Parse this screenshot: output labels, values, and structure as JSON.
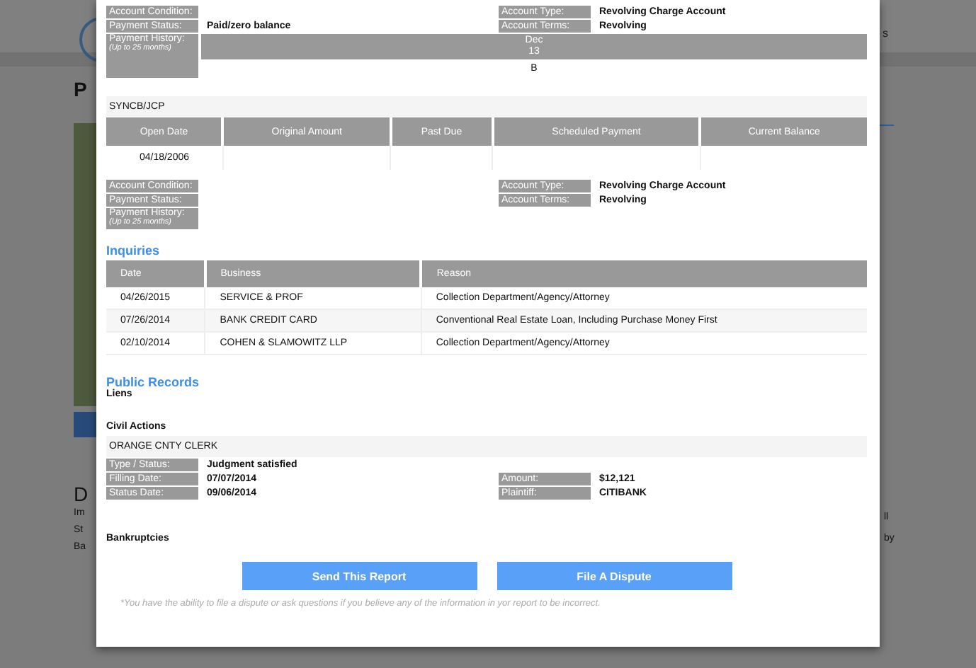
{
  "backdrop": {
    "header_text": "s",
    "page_title": "P",
    "section_title": "D",
    "left_lines": [
      "Im",
      "St",
      "Ba"
    ],
    "right_lines": [
      "ll",
      "by"
    ]
  },
  "account_top": {
    "rows": [
      {
        "left": {
          "label": "Account Condition:"
        },
        "right": {
          "label": "Account Type:",
          "value": "Revolving Charge Account"
        }
      },
      {
        "left": {
          "label": "Payment Status:",
          "value": "Paid/zero balance"
        },
        "right": {
          "label": "Account Terms:",
          "value": "Revolving"
        }
      }
    ],
    "payment_history": {
      "label": "Payment History:",
      "sublabel": "(Up to 25 months)",
      "months": [
        {
          "month": "Dec",
          "year": "13",
          "status": "B"
        }
      ]
    }
  },
  "account": {
    "creditor": "SYNCB/JCP",
    "columns": [
      "Open Date",
      "Original Amount",
      "Past Due",
      "Scheduled Payment",
      "Current Balance"
    ],
    "row": [
      "04/18/2006"
    ],
    "rows": [
      {
        "left": {
          "label": "Account Condition:"
        },
        "right": {
          "label": "Account Type:",
          "value": "Revolving Charge Account"
        }
      },
      {
        "left": {
          "label": "Payment Status:"
        },
        "right": {
          "label": "Account Terms:",
          "value": "Revolving"
        }
      }
    ],
    "payment_history": {
      "label": "Payment History:",
      "sublabel": "(Up to 25 months)"
    }
  },
  "inquiries": {
    "title": "Inquiries",
    "columns": [
      "Date",
      "Business",
      "Reason"
    ],
    "rows": [
      [
        "04/26/2015",
        "SERVICE & PROF",
        "Collection Department/Agency/Attorney"
      ],
      [
        "07/26/2014",
        "BANK CREDIT CARD",
        "Conventional Real Estate Loan, Including Purchase Money First"
      ],
      [
        "02/10/2014",
        "COHEN & SLAMOWITZ LLP",
        "Collection Department/Agency/Attorney"
      ]
    ]
  },
  "public_records": {
    "title": "Public Records",
    "liens_label": "Liens",
    "civil_actions_label": "Civil Actions",
    "civil_actions": [
      {
        "name": "ORANGE CNTY CLERK",
        "rows": [
          {
            "left": {
              "label": "Type / Status:",
              "value": "Judgment satisfied"
            }
          },
          {
            "left": {
              "label": "Filling Date:",
              "value": "07/07/2014"
            },
            "right": {
              "label": "Amount:",
              "value": "$12,121"
            }
          },
          {
            "left": {
              "label": "Status Date:",
              "value": "09/06/2014"
            },
            "right": {
              "label": "Plaintiff:",
              "value": "CITIBANK"
            }
          }
        ]
      }
    ],
    "bankruptcies_label": "Bankruptcies"
  },
  "buttons": [
    "Send This Report",
    "File A Dispute"
  ],
  "footnote": "*You have the ability to file a dispute or ask questions if you believe any of the information in yor report to be incorrect."
}
